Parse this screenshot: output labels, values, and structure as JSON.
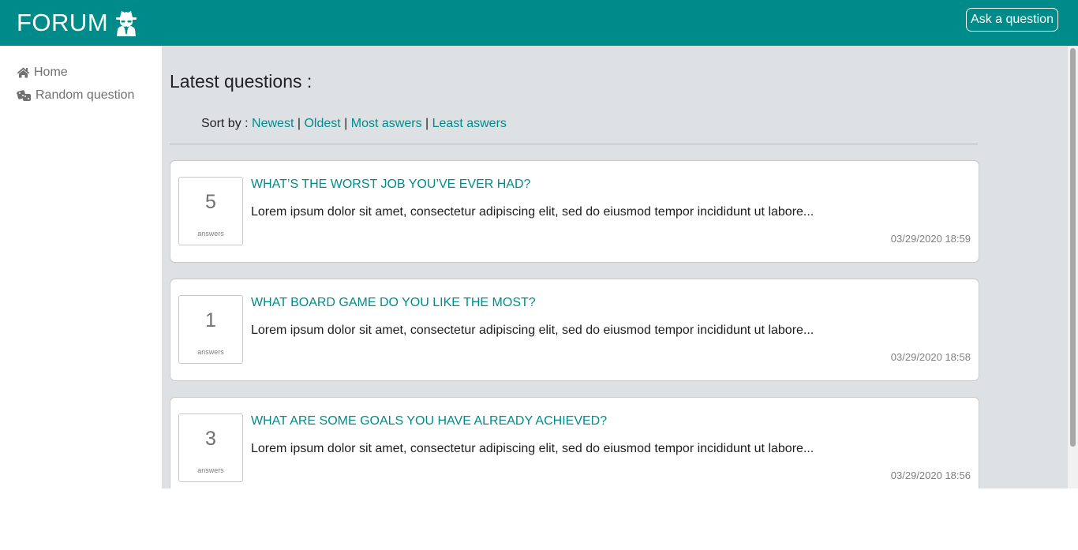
{
  "header": {
    "brand": "FORUM",
    "brand_icon": "spy-incognito-icon",
    "ask_button": "Ask a question",
    "color": "#008b8b"
  },
  "sidebar": {
    "items": [
      {
        "label": "Home",
        "icon": "home-icon"
      },
      {
        "label": "Random question",
        "icon": "dice-icon"
      }
    ]
  },
  "main": {
    "heading": "Latest questions :",
    "sort": {
      "prefix": "Sort by :",
      "options": [
        "Newest",
        "Oldest",
        "Most aswers",
        "Least aswers"
      ],
      "separator": "|"
    },
    "questions": [
      {
        "count": "5",
        "count_label": "answers",
        "title": "WHAT’S THE WORST JOB YOU’VE EVER HAD?",
        "excerpt": "Lorem ipsum dolor sit amet, consectetur adipiscing elit, sed do eiusmod tempor incididunt ut labore...",
        "date": "03/29/2020 18:59"
      },
      {
        "count": "1",
        "count_label": "answers",
        "title": "WHAT BOARD GAME DO YOU LIKE THE MOST?",
        "excerpt": "Lorem ipsum dolor sit amet, consectetur adipiscing elit, sed do eiusmod tempor incididunt ut labore...",
        "date": "03/29/2020 18:58"
      },
      {
        "count": "3",
        "count_label": "answers",
        "title": "WHAT ARE SOME GOALS YOU HAVE ALREADY ACHIEVED?",
        "excerpt": "Lorem ipsum dolor sit amet, consectetur adipiscing elit, sed do eiusmod tempor incididunt ut labore...",
        "date": "03/29/2020 18:56"
      }
    ]
  }
}
